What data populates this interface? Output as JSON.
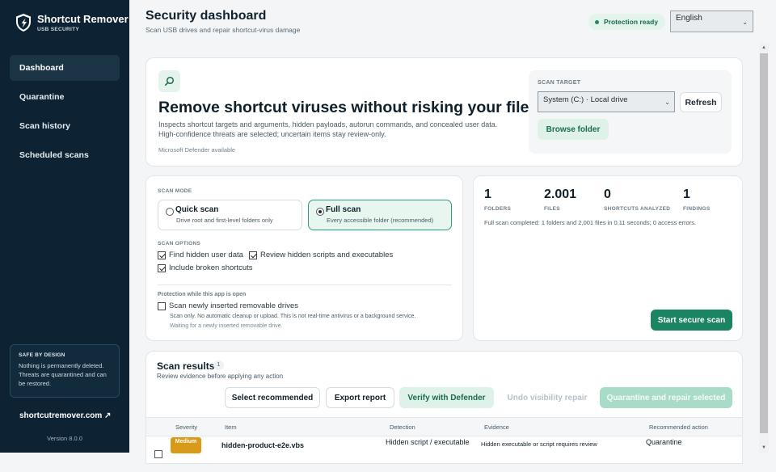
{
  "sidebar": {
    "brand_title": "Shortcut Remover",
    "brand_sub": "USB SECURITY",
    "items": [
      {
        "label": "Dashboard"
      },
      {
        "label": "Quarantine"
      },
      {
        "label": "Scan history"
      },
      {
        "label": "Scheduled scans"
      }
    ],
    "safe_title": "SAFE BY DESIGN",
    "safe_text": "Nothing is permanently deleted. Threats are quarantined and can be restored.",
    "site_link": "shortcutremover.com ↗",
    "version": "Version 8.0.0"
  },
  "header": {
    "title": "Security dashboard",
    "subtitle": "Scan USB drives and repair shortcut-virus damage",
    "status": "Protection ready",
    "language": "English"
  },
  "hero": {
    "title": "Remove shortcut viruses without risking your files",
    "description": "Inspects shortcut targets and arguments, hidden payloads, autorun commands, and concealed user data. High-confidence threats are selected; uncertain items stay review-only.",
    "note": "Microsoft Defender available",
    "target_label": "SCAN TARGET",
    "target_value": "System (C:)  ·  Local drive",
    "refresh": "Refresh",
    "browse": "Browse folder"
  },
  "scan_mode": {
    "label": "SCAN MODE",
    "quick_title": "Quick scan",
    "quick_desc": "Drive root and first-level folders only",
    "full_title": "Full scan",
    "full_desc": "Every accessible folder (recommended)",
    "selected": "full",
    "options_label": "SCAN OPTIONS",
    "opt_hidden_data": "Find hidden user data",
    "opt_hidden_scripts": "Review hidden scripts and executables",
    "opt_broken": "Include broken shortcuts",
    "protect_label": "Protection while this app is open",
    "opt_removable": "Scan newly inserted removable drives",
    "note1": "Scan only. No automatic cleanup or upload. This is not real-time antivirus or a background service.",
    "note2": "Waiting for a newly inserted removable drive."
  },
  "stats": {
    "folders_val": "1",
    "folders_lab": "FOLDERS",
    "files_val": "2.001",
    "files_lab": "FILES",
    "shortcuts_val": "0",
    "shortcuts_lab": "SHORTCUTS ANALYZED",
    "findings_val": "1",
    "findings_lab": "FINDINGS",
    "summary": "Full scan completed: 1 folders and 2,001 files in 0.11 seconds; 0 access errors.",
    "start": "Start secure scan"
  },
  "results": {
    "title": "Scan results",
    "count": "1",
    "subtitle": "Review evidence before applying any action",
    "btn_select": "Select recommended",
    "btn_export": "Export report",
    "btn_verify": "Verify with Defender",
    "btn_undo": "Undo visibility repair",
    "btn_quarantine": "Quarantine and repair selected",
    "columns": [
      "Severity",
      "Item",
      "Detection",
      "Evidence",
      "Recommended action"
    ],
    "rows": [
      {
        "severity": "Medium",
        "item": "hidden-product-e2e.vbs",
        "detection": "Hidden script / executable",
        "evidence": "Hidden executable or script requires review",
        "action": "Quarantine"
      }
    ]
  }
}
